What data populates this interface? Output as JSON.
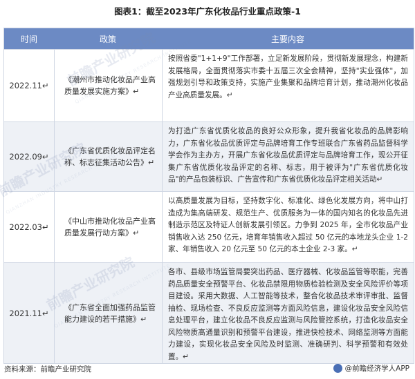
{
  "title": "图表1：截至2023年广东化妆品行业重点政策-1",
  "headers": {
    "time": "时间",
    "policy": "政策",
    "content": "主要内容"
  },
  "rows": [
    {
      "time": "2022.11↵",
      "policy": "《潮州市推动化妆品产业高质量发展实施方案》↵",
      "content": "按照省委\"1+1+9\"工作部署，立足新发展阶段，贯彻新发展理念，构建新发展格局，全面贯彻落实市委十五届三次全会精神，坚持\"实业强体\"，加强规划引导和政策支持，实施产业集聚和品牌培育计划，推动潮州化妆品产业高质量发展。↵"
    },
    {
      "time": "2022.09↵",
      "policy": "《广东省优质化妆品评定名称、标志征集活动公告》↵",
      "content": "为打造广东省优质化妆品的良好公众形象，提升我省化妆品的品牌影响力，广东省化妆品优质评定与品牌培育工作专班联合广东省药品监督科学学会作为主办方，开展广东省化妆品优质评定与品牌培育工作，现公开征集广东省优质化妆品评定的名称、标志，用于被评为\"广东省优质化妆品\"的产品包装标识、广告宣传和广东省优质化妆品评定相关活动↵"
    },
    {
      "time": "2022.03↵",
      "policy": "《中山市推动化妆品产业高质量发展行动方案》↵",
      "content": "以高质量发展为目标，坚持数字化、标准化、绿色化发展方向，将中山打造成为集高端研发、规范生产、优质服务为一体的国内知名的化妆品先进制造示范区及特证人创新发展引领区。力争到 2025 年，全市化妆品产业销售收入达 250 亿元，培育年销售收入超过 50 亿元的本地龙头企业 1-2 家、年销售收入 20 亿元至 50 亿元的本土企业 2-3 家。↵"
    },
    {
      "time": "2021.11↵",
      "policy": "《广东省全面加强药品监管能力建设的若干措施》↵",
      "content": "各市、县级市场监管局要突出药品、医疗器械、化妆品监管等职能，完善药品质量安全预警平台、化妆品禁限用物质检验检测及安全风险评价等项目建设。采用大数据、人工智能等技术，整合化妆品技术审评审批、监督抽检、现场检查、不良反应监测等方面风险信息，建设化妆品安全风险信息处理平台，建立化妆品不良反应监测与风险管控系统，打造化妆品安全风险物质高通量识别和预警平台建设，推进快检技术、网络监测等方面能力建设，实现化妆品安全风险及时监测、准确研判、科学预警和有效处置。↵"
    }
  ],
  "watermark": "前瞻产业研究院",
  "watermark_sub": "QIANZHAN INDUSTRY RESEARCH INSTITUTE",
  "footer": {
    "source": "资料来源：前瞻产业研究院",
    "brand": "@前瞻经济学人APP"
  },
  "colors": {
    "header_bg": "#6c8ac4",
    "alt_row_bg": "#eef1f6",
    "border": "#cfd6e3"
  }
}
